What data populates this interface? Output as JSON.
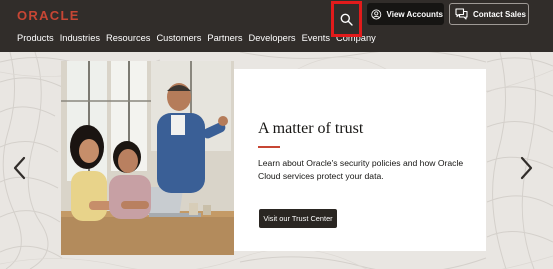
{
  "header": {
    "logo": "ORACLE",
    "nav": [
      "Products",
      "Industries",
      "Resources",
      "Customers",
      "Partners",
      "Developers",
      "Events",
      "Company"
    ],
    "view_accounts_label": "View Accounts",
    "contact_sales_label": "Contact Sales"
  },
  "hero": {
    "title": "A matter of trust",
    "body": "Learn about Oracle's security policies and how Oracle Cloud services protect your data.",
    "cta_label": "Visit our Trust Center"
  },
  "colors": {
    "header_bg": "#312d2a",
    "brand_red": "#c74634",
    "highlight": "#e21b1b"
  }
}
